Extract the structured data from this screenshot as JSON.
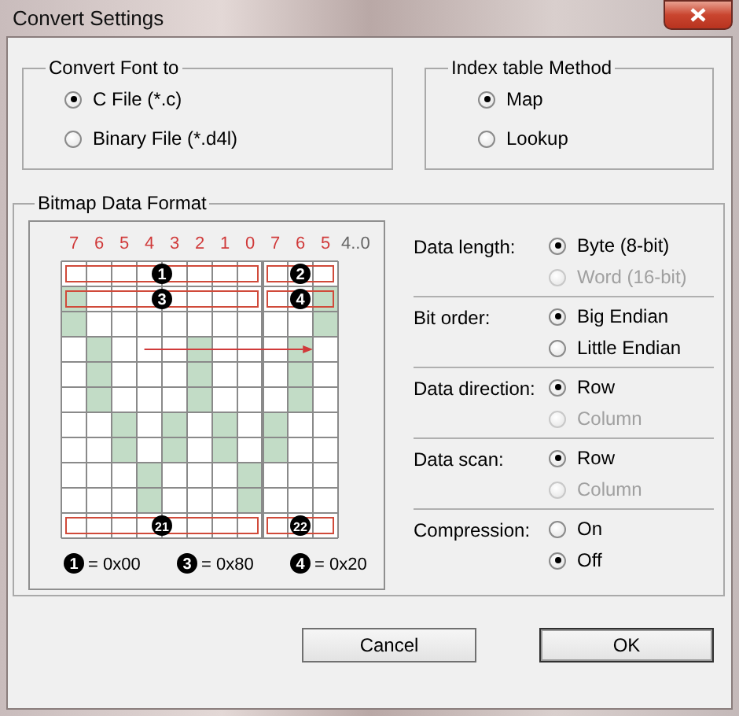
{
  "window": {
    "title": "Convert Settings"
  },
  "convert_font_to": {
    "title": "Convert Font to",
    "options": [
      {
        "label": "C File (*.c)",
        "selected": true
      },
      {
        "label": "Binary File (*.d4l)",
        "selected": false
      }
    ]
  },
  "index_table_method": {
    "title": "Index table Method",
    "options": [
      {
        "label": "Map",
        "selected": true
      },
      {
        "label": "Lookup",
        "selected": false
      }
    ]
  },
  "bitmap_data_format": {
    "title": "Bitmap Data Format",
    "diagram": {
      "bit_labels": [
        "7",
        "6",
        "5",
        "4",
        "3",
        "2",
        "1",
        "0",
        "7",
        "6",
        "5"
      ],
      "bit_range_label": "4..0",
      "bitmap_rows": [
        {
          "cells": [
            false,
            false,
            false,
            false,
            false,
            false,
            false,
            false,
            false,
            false,
            false
          ],
          "markers": [
            "1",
            "2"
          ]
        },
        {
          "cells": [
            true,
            false,
            false,
            false,
            false,
            false,
            false,
            false,
            false,
            false,
            true
          ],
          "markers": [
            "3",
            "4"
          ]
        },
        {
          "cells": [
            true,
            false,
            false,
            false,
            false,
            false,
            false,
            false,
            false,
            false,
            true
          ]
        },
        {
          "cells": [
            false,
            true,
            false,
            false,
            false,
            true,
            false,
            false,
            false,
            true,
            false
          ]
        },
        {
          "cells": [
            false,
            true,
            false,
            false,
            false,
            true,
            false,
            false,
            false,
            true,
            false
          ]
        },
        {
          "cells": [
            false,
            true,
            false,
            false,
            false,
            true,
            false,
            false,
            false,
            true,
            false
          ]
        },
        {
          "cells": [
            false,
            false,
            true,
            false,
            true,
            false,
            true,
            false,
            true,
            false,
            false
          ]
        },
        {
          "cells": [
            false,
            false,
            true,
            false,
            true,
            false,
            true,
            false,
            true,
            false,
            false
          ]
        },
        {
          "cells": [
            false,
            false,
            false,
            true,
            false,
            false,
            false,
            true,
            false,
            false,
            false
          ]
        },
        {
          "cells": [
            false,
            false,
            false,
            true,
            false,
            false,
            false,
            true,
            false,
            false,
            false
          ]
        },
        {
          "cells": [
            false,
            false,
            false,
            false,
            false,
            false,
            false,
            false,
            false,
            false,
            false
          ],
          "markers": [
            "21",
            "22"
          ]
        }
      ],
      "legend": [
        {
          "marker": "1",
          "value": "= 0x00"
        },
        {
          "marker": "3",
          "value": "= 0x80"
        },
        {
          "marker": "4",
          "value": "= 0x20"
        }
      ]
    },
    "settings": [
      {
        "label": "Data length:",
        "options": [
          {
            "label": "Byte (8-bit)",
            "selected": true,
            "disabled": false
          },
          {
            "label": "Word (16-bit)",
            "selected": false,
            "disabled": true
          }
        ]
      },
      {
        "label": "Bit order:",
        "options": [
          {
            "label": "Big Endian",
            "selected": true,
            "disabled": false
          },
          {
            "label": "Little Endian",
            "selected": false,
            "disabled": false
          }
        ]
      },
      {
        "label": "Data direction:",
        "options": [
          {
            "label": "Row",
            "selected": true,
            "disabled": false
          },
          {
            "label": "Column",
            "selected": false,
            "disabled": true
          }
        ]
      },
      {
        "label": "Data scan:",
        "options": [
          {
            "label": "Row",
            "selected": true,
            "disabled": false
          },
          {
            "label": "Column",
            "selected": false,
            "disabled": true
          }
        ]
      },
      {
        "label": "Compression:",
        "options": [
          {
            "label": "On",
            "selected": false,
            "disabled": false
          },
          {
            "label": "Off",
            "selected": true,
            "disabled": false
          }
        ]
      }
    ]
  },
  "buttons": [
    {
      "label": "Cancel",
      "default": false
    },
    {
      "label": "OK",
      "default": true
    }
  ]
}
